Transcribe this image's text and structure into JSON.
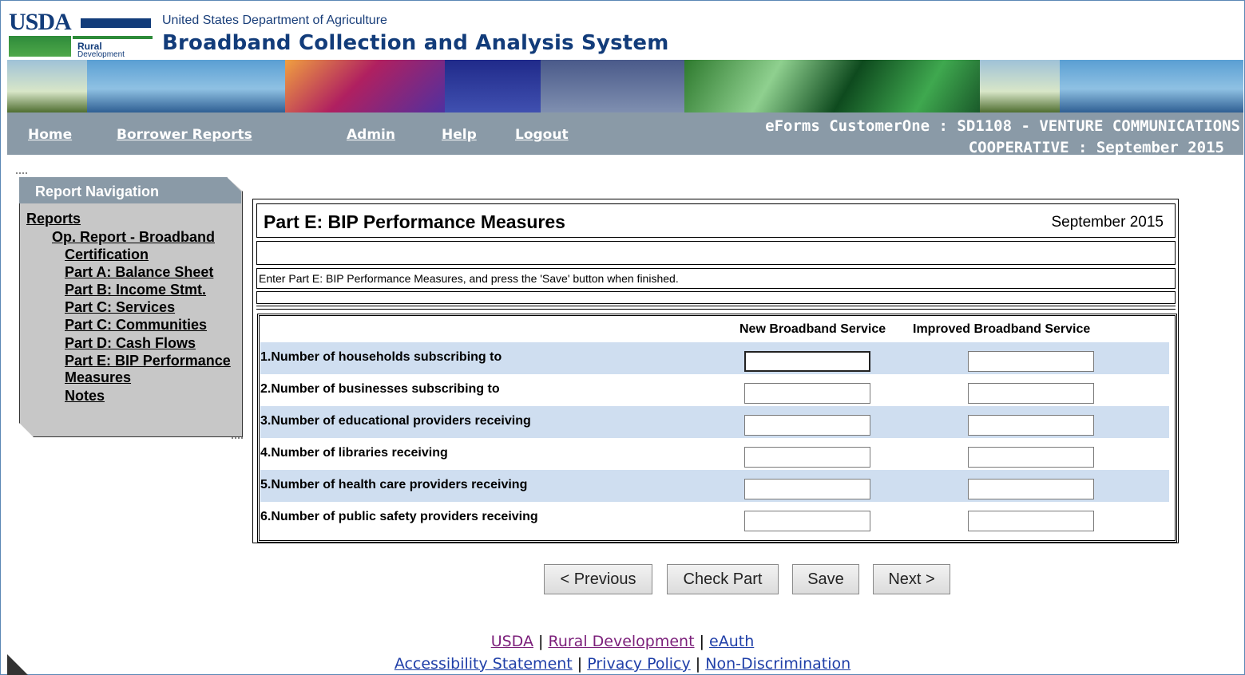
{
  "header": {
    "agency_logo": "USDA",
    "logo_line1": "Rural",
    "logo_line2": "Development",
    "subtitle": "United States Department of Agriculture",
    "title": "Broadband Collection and Analysis System"
  },
  "nav": {
    "home": "Home",
    "borrower_reports": "Borrower Reports",
    "admin": "Admin",
    "help": "Help",
    "logout": "Logout"
  },
  "customer": {
    "line1": "eForms CustomerOne : SD1108 - VENTURE COMMUNICATIONS",
    "line2": "COOPERATIVE : September 2015"
  },
  "report_navigation": {
    "title": "Report Navigation",
    "reports": "Reports",
    "op_report": "Op. Report - Broadband",
    "items": [
      "Certification",
      "Part A: Balance Sheet",
      "Part B: Income Stmt.",
      "Part C: Services",
      "Part C: Communities",
      "Part D: Cash Flows",
      "Part E: BIP Performance",
      "Measures",
      "Notes"
    ]
  },
  "main": {
    "title": "Part E: BIP Performance Measures",
    "date": "September 2015",
    "instructions": "Enter Part E: BIP Performance Measures, and press the 'Save' button when finished.",
    "columns": [
      "New Broadband Service",
      "Improved Broadband Service"
    ],
    "rows": [
      {
        "num": "1.",
        "label": "Number of households subscribing to",
        "new": "",
        "improved": ""
      },
      {
        "num": "2.",
        "label": "Number of businesses subscribing to",
        "new": "",
        "improved": ""
      },
      {
        "num": "3.",
        "label": "Number of educational providers receiving",
        "new": "",
        "improved": ""
      },
      {
        "num": "4.",
        "label": "Number of libraries receiving",
        "new": "",
        "improved": ""
      },
      {
        "num": "5.",
        "label": "Number of health care providers receiving",
        "new": "",
        "improved": ""
      },
      {
        "num": "6.",
        "label": "Number of public safety providers receiving",
        "new": "",
        "improved": ""
      }
    ]
  },
  "buttons": {
    "previous": "< Previous",
    "check_part": "Check Part",
    "save": "Save",
    "next": "Next >"
  },
  "footer": {
    "usda": "USDA",
    "rural_development": "Rural Development",
    "eauth": "eAuth",
    "accessibility": "Accessibility Statement",
    "privacy": "Privacy Policy",
    "non_discrimination": "Non-Discrimination",
    "sep": "|"
  },
  "colors": {
    "nav_bg": "#8a9aa7",
    "title_blue": "#123c7a",
    "row_alt": "#cfdef0",
    "footer_link_blue": "#1f3fa8",
    "footer_link_purple": "#7b1f7a"
  }
}
